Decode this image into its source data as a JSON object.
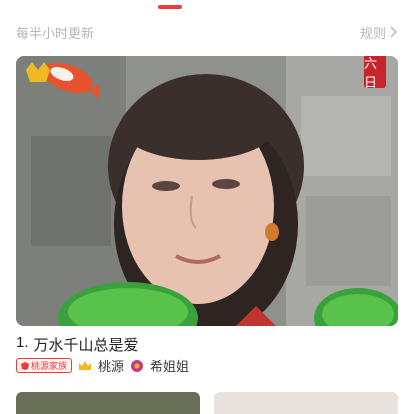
{
  "header": {
    "update_note": "每半小时更新",
    "rules_label": "规则"
  },
  "feature": {
    "date_seal": "六日",
    "rank": "1.",
    "title": "万水千山总是爱"
  },
  "uploader": {
    "family_badge": "桃源家族",
    "names": [
      "桃源",
      "希姐姐"
    ]
  },
  "colors": {
    "accent": "#ee3b3b",
    "muted_text": "#b6b6b6"
  }
}
